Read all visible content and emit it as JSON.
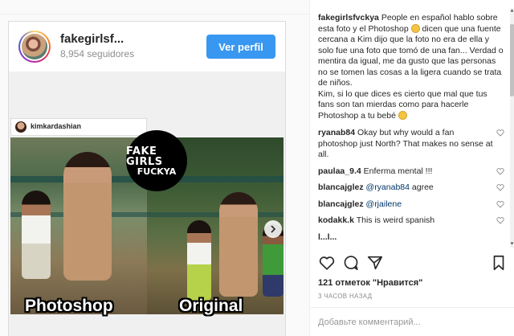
{
  "profile": {
    "username": "fakegirlsf...",
    "followers": "8,954 seguidores",
    "view_profile": "Ver perfil"
  },
  "post_image": {
    "inner_username": "kimkardashian",
    "watermark_line1": "FAKE GIRLS",
    "watermark_line2": "FUCKYA",
    "caption_left": "Photoshop",
    "caption_right": "Original"
  },
  "caption": {
    "username": "fakegirlsfvckya",
    "text": "People en español hablo sobre esta foto y el Photoshop",
    "text_2": " dicen que una fuente cercana a Kim dijo que la foto no era de ella y solo fue una foto que tomó de una fan... Verdad o mentira da igual, me da gusto que las personas no se tomen las cosas a la ligera cuando se trata de niños.",
    "text_3": "Kim, si lo que dices es cierto que mal que tus fans son tan mierdas como para hacerle Photoshop a tu bebé"
  },
  "comments": [
    {
      "username": "ryanab84",
      "text": "Okay but why would a fan photoshop just North? That makes no sense at all."
    },
    {
      "username": "paulaa_9.4",
      "text": "Enferma mental !!!"
    },
    {
      "username": "blancajglez",
      "mention": "@ryanab84",
      "text": " agree"
    },
    {
      "username": "blancajglez",
      "mention": "@rjailene",
      "text": ""
    },
    {
      "username": "kodakk.k",
      "text": "This is weird spanish"
    },
    {
      "username": "l...l...",
      "text": ""
    }
  ],
  "likes": "121 отметок \"Нравится\"",
  "time": "3 ЧАСОВ НАЗАД",
  "comment_placeholder": "Добавьте комментарий...",
  "colors": {
    "accent": "#3897f0",
    "text": "#262626",
    "muted": "#8e8e8e",
    "border": "#dbdbdb"
  },
  "icons": {
    "like": "heart-icon",
    "comment": "comment-icon",
    "share": "share-icon",
    "save": "bookmark-icon",
    "carousel_next": "chevron-right-icon"
  }
}
